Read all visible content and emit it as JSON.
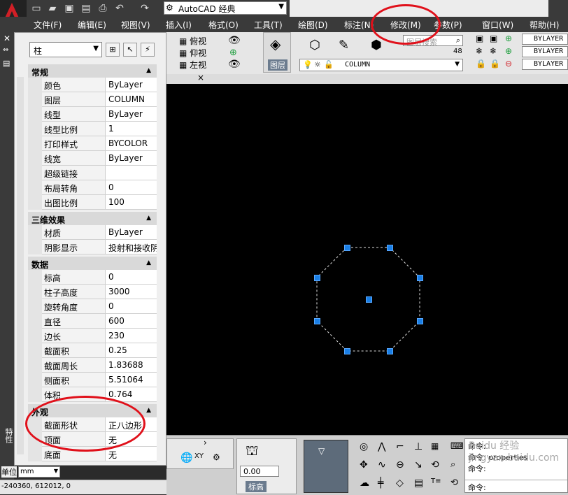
{
  "app": {
    "workspace": "AutoCAD 经典"
  },
  "menu": {
    "items": [
      "文件(F)",
      "编辑(E)",
      "视图(V)",
      "插入(I)",
      "格式(O)",
      "工具(T)",
      "绘图(D)",
      "标注(N)",
      "修改(M)",
      "参数(P)",
      "窗口(W)",
      "帮助(H)"
    ]
  },
  "toolbar": {
    "views": [
      "俯视",
      "仰视",
      "左视"
    ],
    "layer_label": "图层",
    "layer_search_placeholder": "图层搜索",
    "layer_count": "48",
    "current_layer": "COLUMN",
    "bylayer_items": [
      "BYLAYER",
      "BYLAYER",
      "BYLAYER"
    ]
  },
  "palette": {
    "object_type": "柱",
    "sections": [
      {
        "title": "常规",
        "rows": [
          {
            "name": "颜色",
            "value": "ByLayer"
          },
          {
            "name": "图层",
            "value": "COLUMN"
          },
          {
            "name": "线型",
            "value": "ByLayer"
          },
          {
            "name": "线型比例",
            "value": "1"
          },
          {
            "name": "打印样式",
            "value": "BYCOLOR"
          },
          {
            "name": "线宽",
            "value": "ByLayer"
          },
          {
            "name": "超级链接",
            "value": ""
          },
          {
            "name": "布局转角",
            "value": "0"
          },
          {
            "name": "出图比例",
            "value": "100"
          }
        ]
      },
      {
        "title": "三维效果",
        "rows": [
          {
            "name": "材质",
            "value": "ByLayer"
          },
          {
            "name": "阴影显示",
            "value": "投射和接收阴影"
          }
        ]
      },
      {
        "title": "数据",
        "rows": [
          {
            "name": "标高",
            "value": "0"
          },
          {
            "name": "柱子高度",
            "value": "3000"
          },
          {
            "name": "旋转角度",
            "value": "0"
          },
          {
            "name": "直径",
            "value": "600"
          },
          {
            "name": "边长",
            "value": "230"
          },
          {
            "name": "截面积",
            "value": "0.25"
          },
          {
            "name": "截面周长",
            "value": "1.83688"
          },
          {
            "name": "侧面积",
            "value": "5.51064"
          },
          {
            "name": "体积",
            "value": "0.764"
          }
        ]
      },
      {
        "title": "外观",
        "rows": [
          {
            "name": "截面形状",
            "value": "正八边形"
          },
          {
            "name": "顶面",
            "value": "无"
          },
          {
            "name": "底面",
            "value": "无"
          }
        ]
      }
    ],
    "side_label": "特性"
  },
  "bottom": {
    "elevation_value": "0.00",
    "elevation_label": "标高",
    "command_lines": [
      "命令:",
      "命令: properties",
      "命令:"
    ],
    "command_prompt": "命令:"
  },
  "status": {
    "unit_label": "单位",
    "unit_value": "mm",
    "coords": "-240360, 612012, 0"
  },
  "watermark": "Baidu 经验 jingyan.baidu.com",
  "colors": {
    "chrome_dark": "#3a3a3a",
    "canvas": "#000000",
    "grip": "#1a7fe6",
    "annotation_red": "#e0101a"
  }
}
